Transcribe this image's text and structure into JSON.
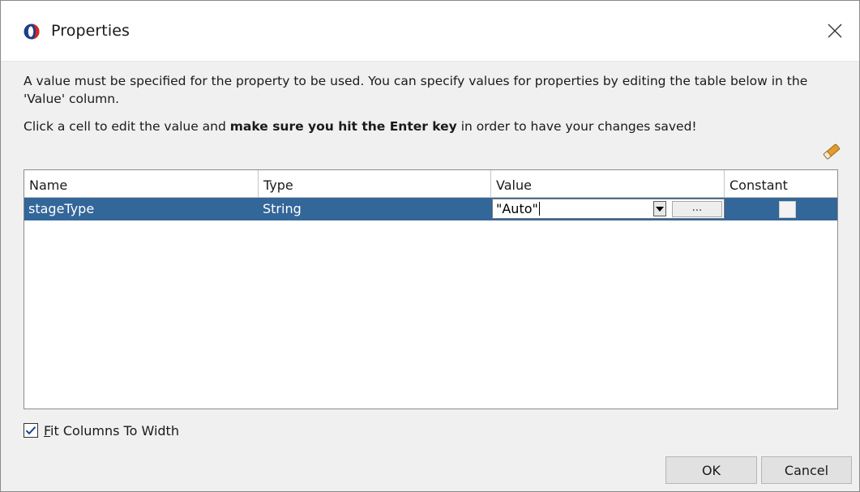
{
  "window": {
    "title": "Properties",
    "icons": {
      "app": "app-logo-icon",
      "close": "close-icon"
    }
  },
  "message": {
    "line1": "A value must be specified for the property to be used. You can specify values for properties by editing the table below in the 'Value' column.",
    "line2_prefix": "Click a cell to edit the value and ",
    "line2_bold": "make sure you hit the Enter key",
    "line2_suffix": " in order to have your changes saved!"
  },
  "toolbar": {
    "clear_icon": "eraser-icon"
  },
  "table": {
    "columns": [
      "Name",
      "Type",
      "Value",
      "Constant"
    ],
    "rows": [
      {
        "name": "stageType",
        "type": "String",
        "value": "\"Auto\"",
        "constant": false,
        "selected": true
      }
    ],
    "value_editor": {
      "ellipsis_label": "...",
      "dropdown_icon": "dropdown-arrow-icon"
    }
  },
  "fit_columns": {
    "label_underlined": "F",
    "label_rest": "it Columns To Width",
    "checked": true
  },
  "buttons": {
    "ok": "OK",
    "cancel": "Cancel"
  },
  "colors": {
    "selection": "#336699",
    "dialog_bg": "#f0f0f0"
  }
}
